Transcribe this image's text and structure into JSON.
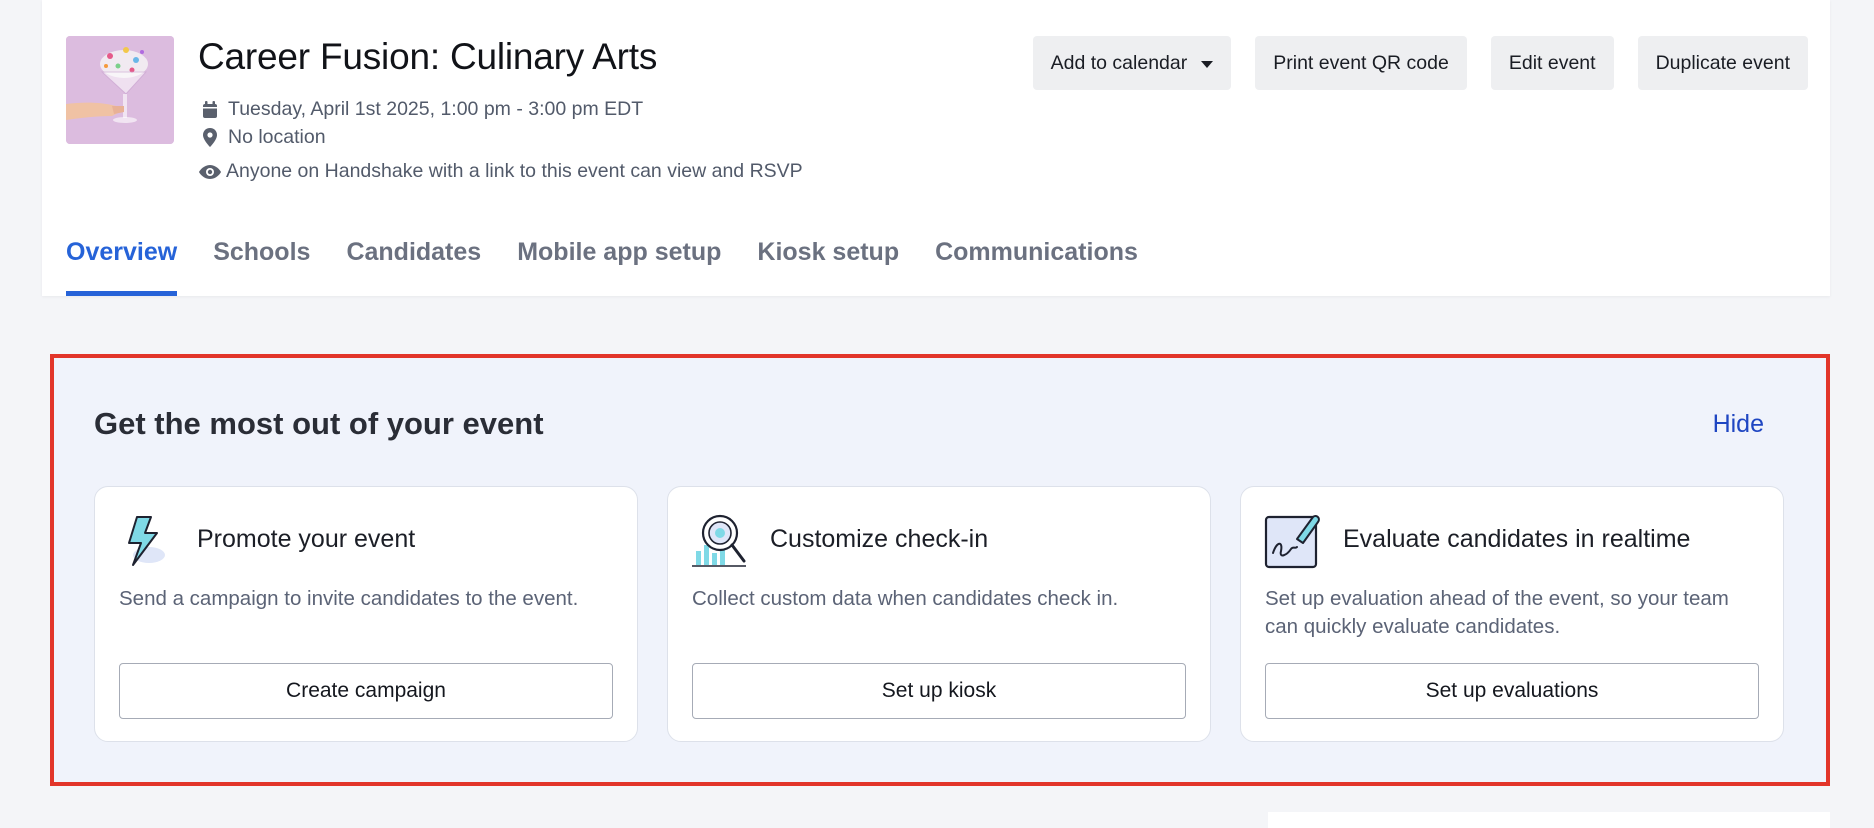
{
  "event": {
    "title": "Career Fusion: Culinary Arts",
    "date": "Tuesday, April 1st 2025, 1:00 pm - 3:00 pm EDT",
    "location": "No location",
    "visibility": "Anyone on Handshake with a link to this event can view and RSVP"
  },
  "actions": {
    "add_to_calendar": "Add to calendar",
    "print_qr": "Print event QR code",
    "edit": "Edit event",
    "duplicate": "Duplicate event"
  },
  "tabs": [
    {
      "label": "Overview",
      "active": true
    },
    {
      "label": "Schools",
      "active": false
    },
    {
      "label": "Candidates",
      "active": false
    },
    {
      "label": "Mobile app setup",
      "active": false
    },
    {
      "label": "Kiosk setup",
      "active": false
    },
    {
      "label": "Communications",
      "active": false
    }
  ],
  "promo": {
    "title": "Get the most out of your event",
    "hide_label": "Hide",
    "cards": [
      {
        "icon": "lightning-icon",
        "title": "Promote your event",
        "description": "Send a campaign to invite candidates to the event.",
        "button": "Create campaign"
      },
      {
        "icon": "magnifier-chart-icon",
        "title": "Customize check-in",
        "description": "Collect custom data when candidates check in.",
        "button": "Set up kiosk"
      },
      {
        "icon": "signature-icon",
        "title": "Evaluate candidates in realtime",
        "description": "Set up evaluation ahead of the event, so your team can quickly evaluate candidates.",
        "button": "Set up evaluations"
      }
    ]
  },
  "colors": {
    "accent": "#2663d8",
    "highlight_border": "#e2352a",
    "promo_bg": "#f0f3fb",
    "link": "#1f46c2"
  }
}
